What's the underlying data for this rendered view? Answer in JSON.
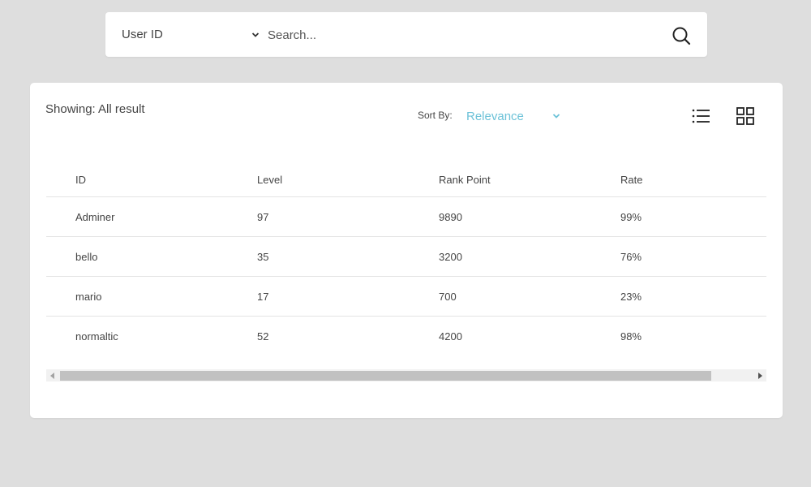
{
  "search": {
    "field_select": "User ID",
    "placeholder": "Search..."
  },
  "results": {
    "showing_label": "Showing: All result",
    "sort_label": "Sort By:",
    "sort_value": "Relevance",
    "accent_color": "#6cc2d8",
    "view_icons": [
      "list-view-icon",
      "grid-view-icon"
    ]
  },
  "table": {
    "headers": [
      "ID",
      "Level",
      "Rank Point",
      "Rate"
    ],
    "rows": [
      [
        "Adminer",
        "97",
        "9890",
        "99%"
      ],
      [
        "bello",
        "35",
        "3200",
        "76%"
      ],
      [
        "mario",
        "17",
        "700",
        "23%"
      ],
      [
        "normaltic",
        "52",
        "4200",
        "98%"
      ]
    ]
  }
}
